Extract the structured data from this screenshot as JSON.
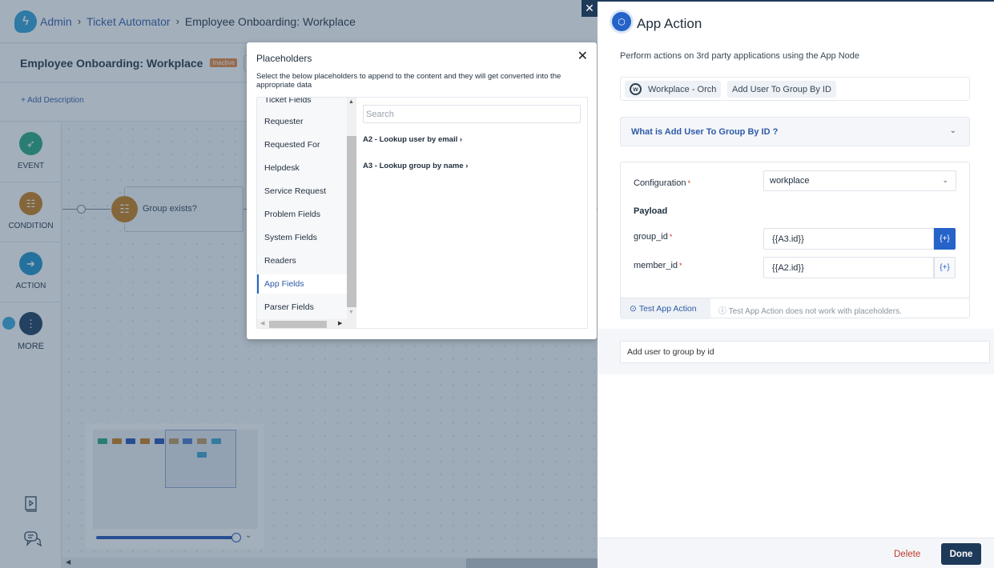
{
  "header": {
    "breadcrumb": [
      "Admin",
      "Ticket Automator"
    ],
    "current": "Employee Onboarding: Workplace"
  },
  "workflow": {
    "title": "Employee Onboarding: Workplace",
    "status_badge": "Inactive",
    "add_description": "+ Add Description"
  },
  "leftnav": {
    "items": [
      {
        "label": "EVENT",
        "color": "#23a47a"
      },
      {
        "label": "CONDITION",
        "color": "#c67a14"
      },
      {
        "label": "ACTION",
        "color": "#1b8fc9"
      },
      {
        "label": "MORE",
        "color": "#16385a"
      }
    ]
  },
  "canvas": {
    "condition_node_label": "Group exists?"
  },
  "minimap": {
    "zoom_fraction": 1.0,
    "node_colors": [
      "#23a47a",
      "#c67a14",
      "#1e4fb5",
      "#c67a14",
      "#1e4fb5",
      "#c8924a",
      "#3d6ec7",
      "#c8924a",
      "#2c9fc9"
    ],
    "second_row_color": "#2c9fc9"
  },
  "placeholders_modal": {
    "title": "Placeholders",
    "description": "Select the below placeholders to append to the content and they will get converted into the appropriate data",
    "categories": [
      {
        "label": "Ticket Fields",
        "active": false
      },
      {
        "label": "Requester",
        "active": false
      },
      {
        "label": "Requested For",
        "active": false
      },
      {
        "label": "Helpdesk",
        "active": false
      },
      {
        "label": "Service Request",
        "active": false
      },
      {
        "label": "Problem Fields",
        "active": false
      },
      {
        "label": "System Fields",
        "active": false
      },
      {
        "label": "Readers",
        "active": false
      },
      {
        "label": "App Fields",
        "active": true
      },
      {
        "label": "Parser Fields",
        "active": false
      }
    ],
    "search_placeholder": "Search",
    "search_value": "",
    "items": [
      {
        "label": "A2 - Lookup user by email ›"
      },
      {
        "label": "A3 - Lookup group by name ›"
      }
    ]
  },
  "app_action_panel": {
    "title": "App Action",
    "description": "Perform actions on 3rd party applications using the App Node",
    "app_chip": "Workplace - Orch",
    "action_chip": "Add User To Group By ID",
    "accordion_label": "What is Add User To Group By ID ?",
    "configuration_label": "Configuration",
    "configuration_value": "workplace",
    "payload_title": "Payload",
    "fields": [
      {
        "label": "group_id",
        "value": "{{A3.id}}",
        "button": "{+}"
      },
      {
        "label": "member_id",
        "value": "{{A2.id}}",
        "button": "{+}"
      }
    ],
    "test_button": "Test App Action",
    "test_note": "Test App Action does not work with placeholders.",
    "note_value": "Add user to group by id",
    "delete_label": "Delete",
    "done_label": "Done"
  }
}
